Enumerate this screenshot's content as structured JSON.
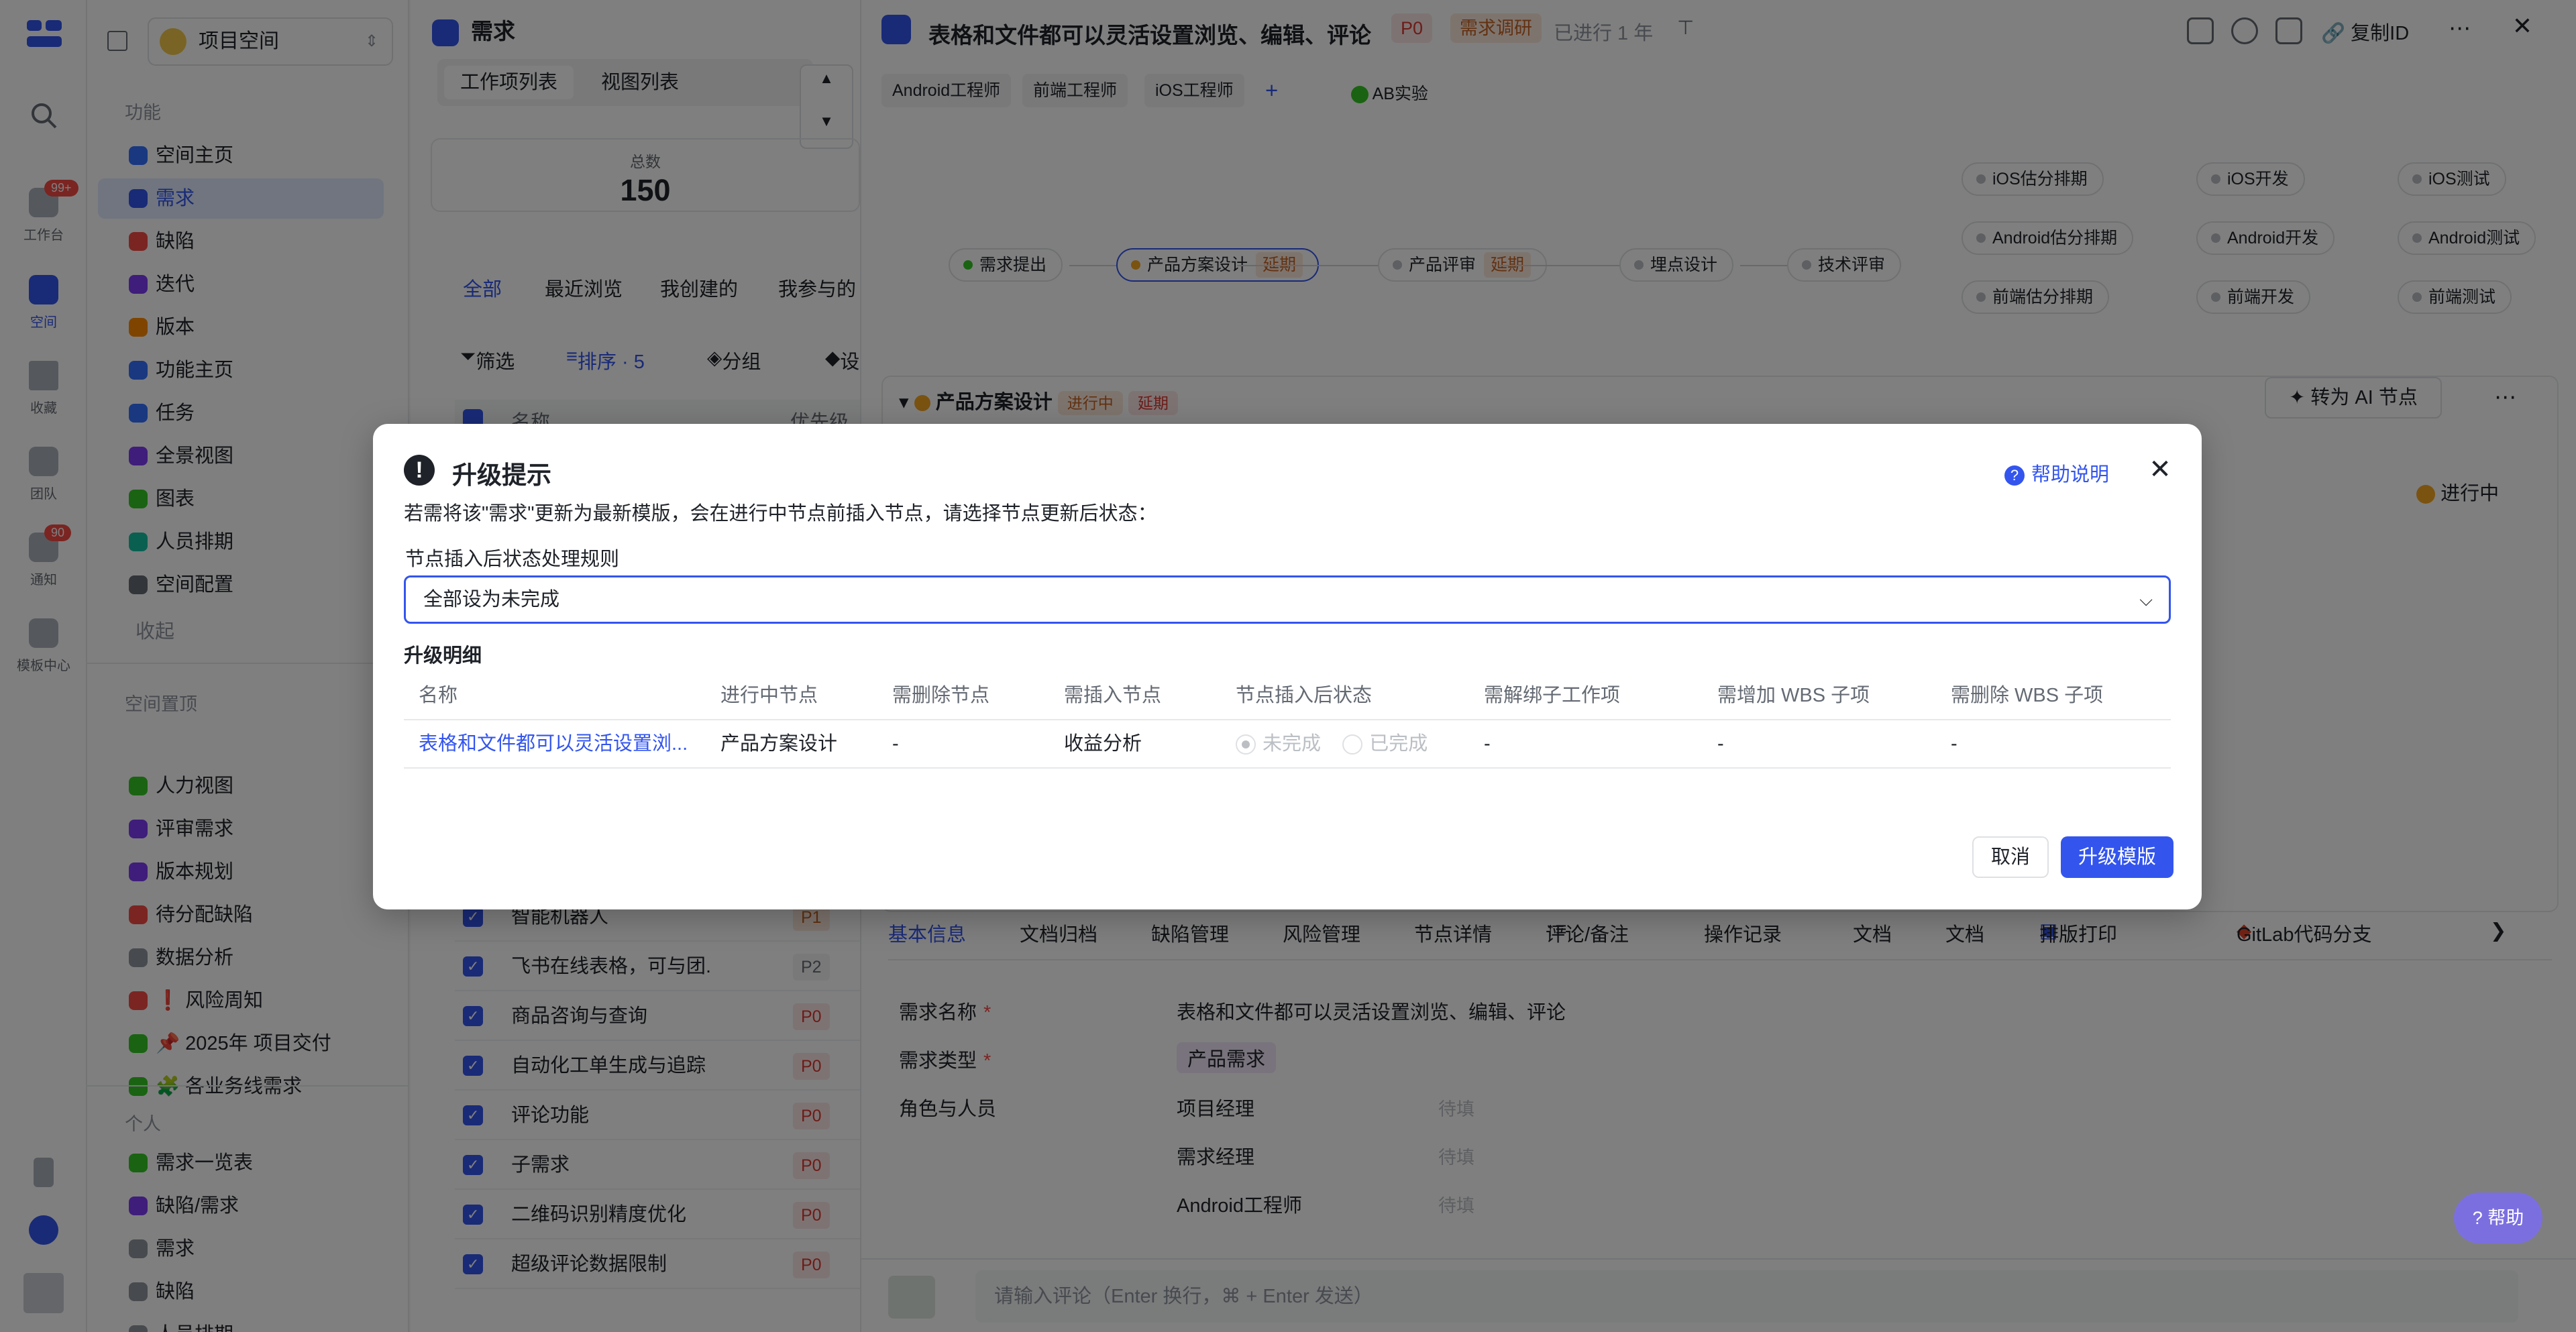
{
  "rail": {
    "items": [
      {
        "label": "工作台",
        "badge": "99+"
      },
      {
        "label": "空间",
        "badge": ""
      },
      {
        "label": "收藏",
        "badge": ""
      },
      {
        "label": "团队",
        "badge": ""
      },
      {
        "label": "通知",
        "badge": "90"
      },
      {
        "label": "模板中心",
        "badge": ""
      }
    ]
  },
  "sidebar": {
    "project": "项目空间",
    "section_features": "功能",
    "items": [
      {
        "label": "空间主页",
        "color": "#3370ff"
      },
      {
        "label": "需求",
        "color": "#3355ee"
      },
      {
        "label": "缺陷",
        "color": "#f54a45"
      },
      {
        "label": "迭代",
        "color": "#7f3bf5"
      },
      {
        "label": "版本",
        "color": "#ff8800"
      },
      {
        "label": "功能主页",
        "color": "#3370ff"
      },
      {
        "label": "任务",
        "color": "#3370ff"
      },
      {
        "label": "全景视图",
        "color": "#7f3bf5"
      },
      {
        "label": "图表",
        "color": "#34c724"
      },
      {
        "label": "人员排期",
        "color": "#14c0a0"
      },
      {
        "label": "空间配置",
        "color": "#646a73"
      }
    ],
    "collapse": "收起",
    "section_pinned": "空间置顶",
    "pinned": [
      {
        "label": "人力视图",
        "color": "#34c724"
      },
      {
        "label": "评审需求",
        "color": "#7f3bf5"
      },
      {
        "label": "版本规划",
        "color": "#7f3bf5"
      },
      {
        "label": "待分配缺陷",
        "color": "#f54a45"
      },
      {
        "label": "数据分析",
        "color": "#8f959e"
      },
      {
        "label": "❗ 风险周知",
        "color": "#f54a45"
      },
      {
        "label": "📌 2025年 项目交付",
        "color": "#34c724"
      },
      {
        "label": "🧩 各业务线需求",
        "color": "#34c724"
      }
    ],
    "section_personal": "个人",
    "personal": [
      {
        "label": "需求一览表",
        "color": "#34c724"
      },
      {
        "label": "缺陷/需求",
        "color": "#7f3bf5"
      },
      {
        "label": "需求",
        "color": "#8f959e"
      },
      {
        "label": "缺陷",
        "color": "#8f959e"
      },
      {
        "label": "人员排期",
        "color": "#8f959e"
      }
    ]
  },
  "list": {
    "title": "需求",
    "tabs": [
      "工作项列表",
      "视图列表"
    ],
    "total_label": "总数",
    "total_value": "150",
    "filter_tabs": [
      "全部",
      "最近浏览",
      "我创建的",
      "我参与的"
    ],
    "toolbar": {
      "filter": "筛选",
      "sort": "排序 · 5",
      "group": "分组",
      "settings": "设"
    },
    "col_name": "名称",
    "col_priority": "优先级",
    "rows": [
      {
        "name": "智能机器人",
        "priority": "P1"
      },
      {
        "name": "飞书在线表格，可与团...",
        "priority": "P2"
      },
      {
        "name": "商品咨询与查询",
        "priority": "P0"
      },
      {
        "name": "自动化工单生成与追踪",
        "priority": "P0"
      },
      {
        "name": "评论功能",
        "priority": "P0"
      },
      {
        "name": "子需求",
        "priority": "P0"
      },
      {
        "name": "二维码识别精度优化",
        "priority": "P0"
      },
      {
        "name": "超级评论数据限制",
        "priority": "P0"
      }
    ]
  },
  "detail": {
    "title": "表格和文件都可以灵活设置浏览、编辑、评论",
    "priority": "P0",
    "stage": "需求调研",
    "elapsed": "已进行 1 年",
    "copy_id": "复制ID",
    "roles": [
      "Android工程师",
      "前端工程师",
      "iOS工程师"
    ],
    "ab": "AB实验",
    "flow": {
      "main": [
        {
          "label": "需求提出",
          "tag": "",
          "color": "#34c724"
        },
        {
          "label": "产品方案设计",
          "tag": "延期",
          "color": "#f5a623"
        },
        {
          "label": "产品评审",
          "tag": "延期",
          "color": "#bbbfc4"
        },
        {
          "label": "埋点设计",
          "tag": "",
          "color": "#bbbfc4"
        },
        {
          "label": "技术评审",
          "tag": "",
          "color": "#bbbfc4"
        }
      ],
      "branches": [
        [
          "iOS估分排期",
          "iOS开发",
          "iOS测试"
        ],
        [
          "Android估分排期",
          "Android开发",
          "Android测试"
        ],
        [
          "前端估分排期",
          "前端开发",
          "前端测试"
        ]
      ]
    },
    "node_section": {
      "name": "产品方案设计",
      "status": "进行中",
      "tag": "延期",
      "ai_button": "转为 AI 节点",
      "state": "进行中"
    },
    "tabs": [
      "基本信息",
      "文档归档",
      "缺陷管理",
      "风险管理",
      "节点详情",
      "评论/备注",
      "操作记录",
      "文档",
      "文档",
      "排版打印",
      "GitLab代码分支"
    ],
    "fields": [
      {
        "label": "需求名称",
        "required": "*",
        "value": "表格和文件都可以灵活设置浏览、编辑、评论",
        "placeholder": ""
      },
      {
        "label": "需求类型",
        "required": "*",
        "value": "产品需求",
        "placeholder": ""
      },
      {
        "label": "角色与人员",
        "required": "",
        "value": "项目经理",
        "placeholder": "待填"
      },
      {
        "label": "",
        "required": "",
        "value": "需求经理",
        "placeholder": "待填"
      },
      {
        "label": "",
        "required": "",
        "value": "Android工程师",
        "placeholder": "待填"
      }
    ],
    "comment_placeholder": "请输入评论（Enter 换行，⌘ + Enter 发送）"
  },
  "modal": {
    "title": "升级提示",
    "help": "帮助说明",
    "description": "若需将该\"需求\"更新为最新模版，会在进行中节点前插入节点，请选择节点更新后状态：",
    "rule_label": "节点插入后状态处理规则",
    "rule_value": "全部设为未完成",
    "detail_label": "升级明细",
    "columns": [
      "名称",
      "进行中节点",
      "需删除节点",
      "需插入节点",
      "节点插入后状态",
      "需解绑子工作项",
      "需增加 WBS 子项",
      "需删除 WBS 子项"
    ],
    "row": {
      "name": "表格和文件都可以灵活设置浏...",
      "in_progress": "产品方案设计",
      "delete_nodes": "-",
      "insert_nodes": "收益分析",
      "status_option_1": "未完成",
      "status_option_2": "已完成",
      "unbind": "-",
      "wbs_add": "-",
      "wbs_delete": "-"
    },
    "cancel": "取消",
    "confirm": "升级模版"
  },
  "help_float": "帮助",
  "colors": {
    "accent": "#3355ee",
    "danger": "#f54a45",
    "overlay": "rgba(0,0,0,0.5)"
  }
}
